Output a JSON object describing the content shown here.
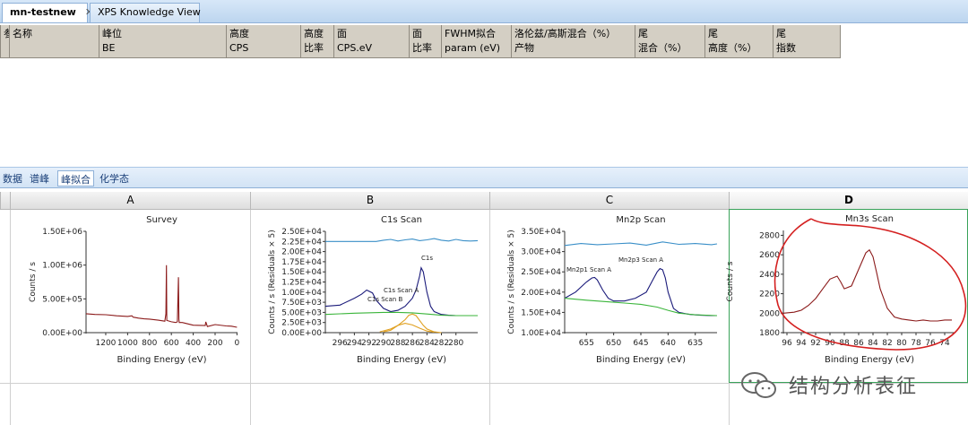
{
  "tabs": [
    {
      "label": "mn-testnew",
      "active": true,
      "close": "✕"
    },
    {
      "label": "XPS Knowledge View",
      "active": false
    }
  ],
  "table_headers": [
    {
      "line1": "参",
      "line2": ""
    },
    {
      "line1": "名称",
      "line2": ""
    },
    {
      "line1": "峰位",
      "line2": "BE"
    },
    {
      "line1": "高度",
      "line2": "CPS"
    },
    {
      "line1": "高度",
      "line2": "比率"
    },
    {
      "line1": "面",
      "line2": "CPS.eV"
    },
    {
      "line1": "面",
      "line2": "比率"
    },
    {
      "line1": "FWHM拟合",
      "line2": "param (eV)"
    },
    {
      "line1": "洛伦兹/高斯混合（%）",
      "line2": "产物"
    },
    {
      "line1": "尾",
      "line2": "混合（%）"
    },
    {
      "line1": "尾",
      "line2": "高度（%）"
    },
    {
      "line1": "尾",
      "line2": "指数"
    }
  ],
  "subtabs": [
    {
      "label": "数据",
      "active": false
    },
    {
      "label": "谱峰",
      "active": false
    },
    {
      "label": "峰拟合",
      "active": true
    },
    {
      "label": "化学态",
      "active": false
    }
  ],
  "grid_columns": [
    "A",
    "B",
    "C",
    "D"
  ],
  "selected_column": "D",
  "watermark": "结构分析表征",
  "colors": {
    "spectrum": "#8b1a1a",
    "envelope": "#1a1a7a",
    "residual": "#3a8fc8",
    "background": "#3ab53a",
    "component": "#e0a020",
    "annotation_red": "#d42020"
  },
  "chart_data": [
    {
      "type": "line",
      "title": "Survey",
      "xlabel": "Binding Energy (eV)",
      "ylabel": "Counts / s",
      "x_reversed": true,
      "xlim": [
        1380,
        -5
      ],
      "ylim": [
        0,
        1500000
      ],
      "xticks": [
        "1200",
        "1000",
        "800",
        "600",
        "400",
        "200",
        "0"
      ],
      "xtick_values": [
        1200,
        1000,
        800,
        600,
        400,
        200,
        0
      ],
      "yticks": [
        "0.00E+00",
        "5.00E+05",
        "1.00E+06",
        "1.50E+06"
      ],
      "ytick_values": [
        0,
        500000,
        1000000,
        1500000
      ],
      "series": [
        {
          "x": [
            1380,
            1300,
            1200,
            1100,
            1000,
            960,
            950,
            900,
            850,
            800,
            720,
            660,
            650,
            645,
            642,
            600,
            560,
            545,
            535,
            531,
            528,
            500,
            450,
            400,
            290,
            285,
            270,
            200,
            100,
            50,
            0
          ],
          "y": [
            280000,
            270000,
            265000,
            250000,
            240000,
            250000,
            230000,
            215000,
            205000,
            200000,
            185000,
            170000,
            280000,
            1000000,
            180000,
            160000,
            150000,
            160000,
            820000,
            200000,
            150000,
            150000,
            130000,
            110000,
            105000,
            160000,
            90000,
            120000,
            100000,
            95000,
            80000
          ]
        }
      ]
    },
    {
      "type": "line",
      "title": "C1s Scan",
      "xlabel": "Binding Energy (eV)",
      "ylabel": "Counts / s  (Residuals × 5)",
      "x_reversed": true,
      "xlim": [
        298,
        277
      ],
      "ylim": [
        0,
        25000
      ],
      "xticks": [
        "296",
        "294",
        "292",
        "290",
        "288",
        "286",
        "284",
        "282",
        "280"
      ],
      "xtick_values": [
        296,
        294,
        292,
        290,
        288,
        286,
        284,
        282,
        280
      ],
      "yticks": [
        "0.00E+00",
        "2.50E+03",
        "5.00E+03",
        "7.50E+03",
        "1.00E+04",
        "1.25E+04",
        "1.50E+04",
        "1.75E+04",
        "2.00E+04",
        "2.25E+04",
        "2.50E+04"
      ],
      "ytick_values": [
        0,
        2500,
        5000,
        7500,
        10000,
        12500,
        15000,
        17500,
        20000,
        22500,
        25000
      ],
      "annotations": [
        "C1s",
        "C1s Scan A",
        "C1s Scan B"
      ],
      "series": [
        {
          "x": [
            298,
            296,
            294,
            293,
            292.3,
            291.5,
            291,
            290,
            289,
            288,
            287,
            286,
            285.5,
            285,
            284.8,
            284.5,
            284,
            283.5,
            283,
            282,
            281,
            280,
            278,
            277
          ],
          "y": [
            6500,
            6800,
            8500,
            9500,
            10500,
            9800,
            8000,
            6000,
            5200,
            5500,
            6500,
            8500,
            10500,
            14000,
            16000,
            15000,
            10000,
            6500,
            5200,
            4500,
            4300,
            4200,
            4200,
            4200
          ]
        },
        {
          "x": [
            290,
            289,
            288,
            287,
            286.5,
            286,
            285.5,
            285,
            284.5,
            284,
            283,
            282
          ],
          "y": [
            200,
            600,
            1800,
            3200,
            4300,
            4600,
            4200,
            3000,
            1800,
            900,
            200,
            0
          ]
        },
        {
          "x": [
            290.5,
            289,
            288,
            287,
            286,
            285,
            284,
            283
          ],
          "y": [
            200,
            900,
            1800,
            2300,
            1900,
            1100,
            400,
            100
          ]
        },
        {
          "x": [
            298,
            294,
            290,
            288,
            286,
            284,
            282,
            280,
            277
          ],
          "y": [
            4500,
            4800,
            5000,
            5000,
            4900,
            4600,
            4300,
            4200,
            4200
          ]
        },
        {
          "x": [
            298,
            296,
            295,
            294,
            293,
            292,
            291,
            290,
            289,
            288,
            287,
            286,
            285,
            284,
            283,
            282,
            281,
            280,
            279,
            278,
            277
          ],
          "y": [
            22500,
            22500,
            22500,
            22500,
            22500,
            22500,
            22500,
            22800,
            23000,
            22600,
            22900,
            23100,
            22700,
            22900,
            23200,
            22800,
            22600,
            23000,
            22700,
            22600,
            22700
          ]
        }
      ]
    },
    {
      "type": "line",
      "title": "Mn2p Scan",
      "xlabel": "Binding Energy (eV)",
      "ylabel": "Counts / s  (Residuals × 5)",
      "x_reversed": true,
      "xlim": [
        659,
        631
      ],
      "ylim": [
        10000,
        35000
      ],
      "xticks": [
        "655",
        "650",
        "645",
        "640",
        "635"
      ],
      "xtick_values": [
        655,
        650,
        645,
        640,
        635
      ],
      "yticks": [
        "1.00E+04",
        "1.50E+04",
        "2.00E+04",
        "2.50E+04",
        "3.00E+04",
        "3.50E+04"
      ],
      "ytick_values": [
        10000,
        15000,
        20000,
        25000,
        30000,
        35000
      ],
      "annotations": [
        "Mn2p1 Scan A",
        "Mn2p3 Scan A"
      ],
      "series": [
        {
          "x": [
            659,
            657,
            655,
            654,
            653.5,
            653,
            652,
            651,
            650,
            648,
            646,
            644,
            643,
            642,
            641.5,
            641,
            640.5,
            640,
            639,
            638,
            636,
            634,
            632,
            631
          ],
          "y": [
            18500,
            20000,
            22500,
            23500,
            23600,
            23000,
            20500,
            18500,
            17800,
            17800,
            18500,
            20000,
            22500,
            25000,
            25800,
            25500,
            23500,
            20000,
            16000,
            15000,
            14500,
            14300,
            14200,
            14200
          ]
        },
        {
          "x": [
            659,
            655,
            650,
            648,
            645,
            642,
            640,
            638,
            635,
            631
          ],
          "y": [
            18500,
            18000,
            17500,
            17300,
            17000,
            16300,
            15500,
            14800,
            14400,
            14200
          ]
        },
        {
          "x": [
            659,
            656,
            653,
            650,
            647,
            644,
            641,
            638,
            635,
            632,
            631
          ],
          "y": [
            31500,
            32000,
            31700,
            31900,
            32100,
            31600,
            32400,
            31800,
            32000,
            31700,
            31900
          ]
        }
      ]
    },
    {
      "type": "line",
      "title": "Mn3s Scan",
      "xlabel": "Binding Energy (eV)",
      "ylabel": "Counts / s",
      "x_reversed": true,
      "xlim": [
        96.5,
        72.5
      ],
      "ylim": [
        1800,
        2850
      ],
      "xticks": [
        "96",
        "94",
        "92",
        "90",
        "88",
        "86",
        "84",
        "82",
        "80",
        "78",
        "76",
        "74"
      ],
      "xtick_values": [
        96,
        94,
        92,
        90,
        88,
        86,
        84,
        82,
        80,
        78,
        76,
        74
      ],
      "yticks": [
        "1800",
        "2000",
        "2200",
        "2400",
        "2600",
        "2800"
      ],
      "ytick_values": [
        1800,
        2000,
        2200,
        2400,
        2600,
        2800
      ],
      "series": [
        {
          "x": [
            96.5,
            95,
            94,
            93,
            92,
            91,
            90,
            89,
            88.5,
            88,
            87,
            86,
            85,
            84.5,
            84,
            83.5,
            83,
            82,
            81,
            80,
            79,
            78,
            77,
            76,
            75,
            74,
            73
          ],
          "y": [
            2000,
            2010,
            2030,
            2080,
            2150,
            2250,
            2350,
            2380,
            2320,
            2250,
            2280,
            2450,
            2620,
            2650,
            2580,
            2420,
            2250,
            2050,
            1960,
            1940,
            1930,
            1920,
            1930,
            1920,
            1920,
            1930,
            1930
          ]
        }
      ]
    }
  ]
}
